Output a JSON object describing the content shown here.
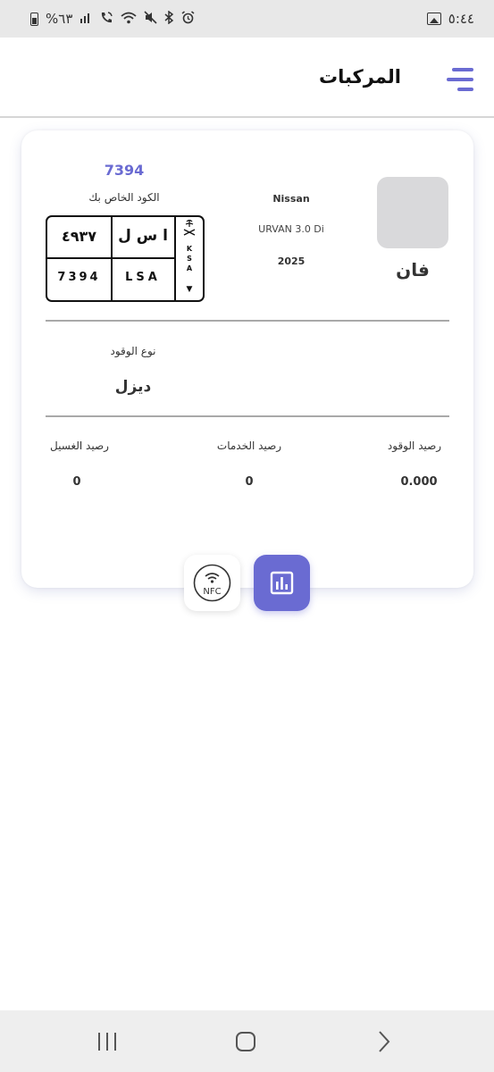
{
  "statusbar": {
    "time": "٥:٤٤",
    "battery": "%٦٣",
    "icons": [
      "gallery-icon",
      "battery-icon",
      "signal-icon",
      "call-wifi-icon",
      "wifi-icon",
      "mute-icon",
      "bluetooth-icon",
      "alarm-icon"
    ]
  },
  "header": {
    "title": "المركبات",
    "menu_icon": "hamburger-menu-icon"
  },
  "vehicle": {
    "type": "فان",
    "make": "Nissan",
    "model": "URVAN 3.0 Di",
    "year": "2025",
    "code_value": "7394",
    "code_label": "الكود الخاص بك",
    "plate": {
      "arabic_numbers": "٤٩٣٧",
      "arabic_letters": "ا س ل",
      "english_numbers": "7394",
      "english_letters": "LSA",
      "emblem": "saudi-emblem-icon",
      "country": [
        "K",
        "S",
        "A"
      ],
      "arrow": "▼"
    },
    "fuel_type_label": "نوع الوقود",
    "fuel_type_value": "ديزل"
  },
  "balances": {
    "fuel_label": "رصيد الوقود",
    "fuel_value": "0.000",
    "services_label": "رصيد الخدمات",
    "services_value": "0",
    "wash_label": "رصيد الغسيل",
    "wash_value": "0"
  },
  "actions": {
    "nfc_label": "NFC",
    "stats_icon": "bar-chart-icon"
  },
  "colors": {
    "accent": "#6a6bd2",
    "statusbar_bg": "#e8e8e8",
    "navbar_bg": "#eeeeee",
    "thumb_bg": "#d9d9db"
  }
}
